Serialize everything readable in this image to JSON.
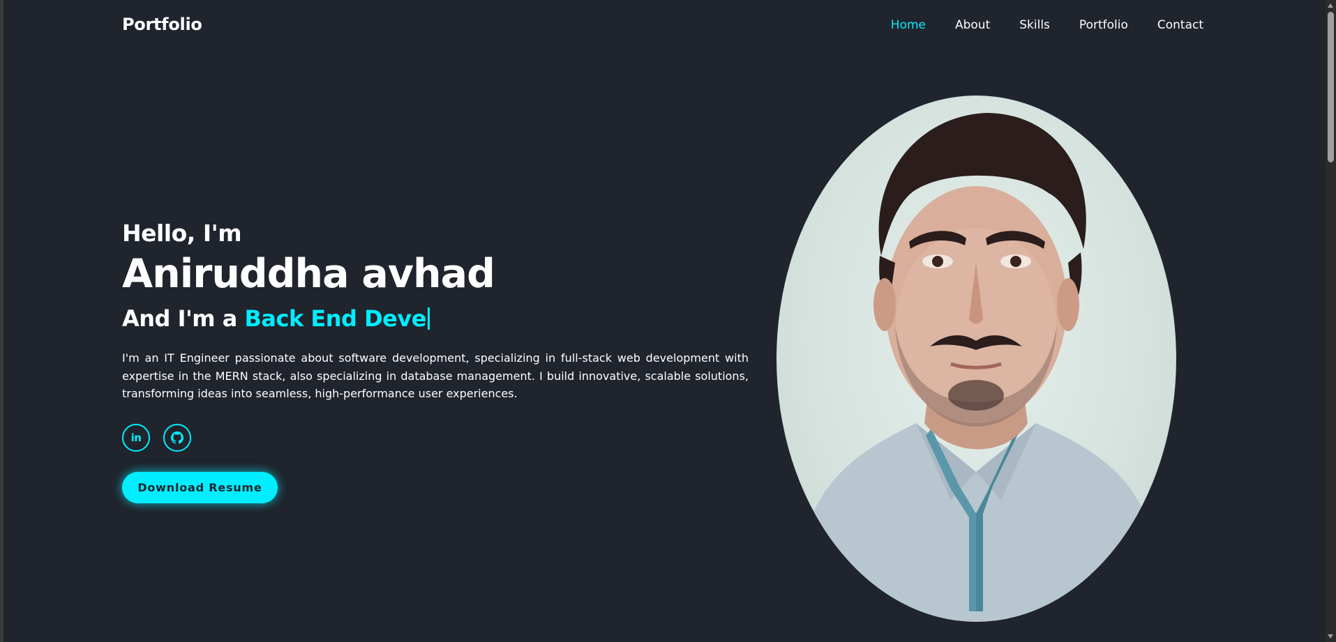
{
  "header": {
    "logo": "Portfolio",
    "nav": [
      {
        "label": "Home",
        "active": true
      },
      {
        "label": "About",
        "active": false
      },
      {
        "label": "Skills",
        "active": false
      },
      {
        "label": "Portfolio",
        "active": false
      },
      {
        "label": "Contact",
        "active": false
      }
    ]
  },
  "hero": {
    "greeting": "Hello, I'm",
    "name": "Aniruddha avhad",
    "role_prefix": "And I'm a",
    "role_typed": "Back End Deve",
    "description": "I'm an IT Engineer passionate about software development, specializing in full-stack web development with expertise in the MERN stack, also specializing in database management. I build innovative, scalable solutions, transforming ideas into seamless, high-performance user experiences.",
    "social": [
      {
        "icon": "linkedin-icon",
        "glyph": "in"
      },
      {
        "icon": "github-icon"
      }
    ],
    "resume_button": "Download Resume"
  },
  "colors": {
    "background": "#1f242d",
    "accent": "#00eeff",
    "text": "#ffffff"
  }
}
